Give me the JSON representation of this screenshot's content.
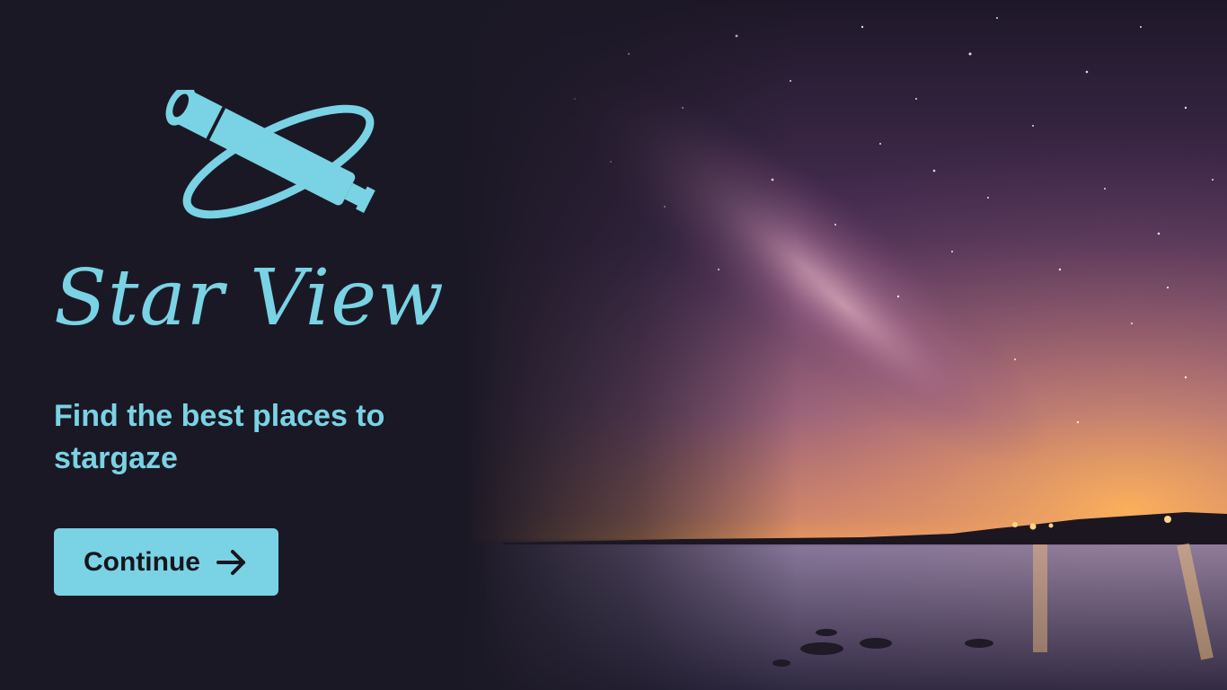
{
  "app": {
    "title": "Star View",
    "tagline": "Find the best places to stargaze",
    "continue_label": "Continue"
  },
  "icons": {
    "logo": "telescope-logo-icon",
    "continue": "arrow-right-icon"
  },
  "colors": {
    "background": "#1b1825",
    "accent": "#79d3e4",
    "button_text": "#17151f",
    "sky_purple": "#7a4a86",
    "horizon_glow": "#f2a257"
  }
}
